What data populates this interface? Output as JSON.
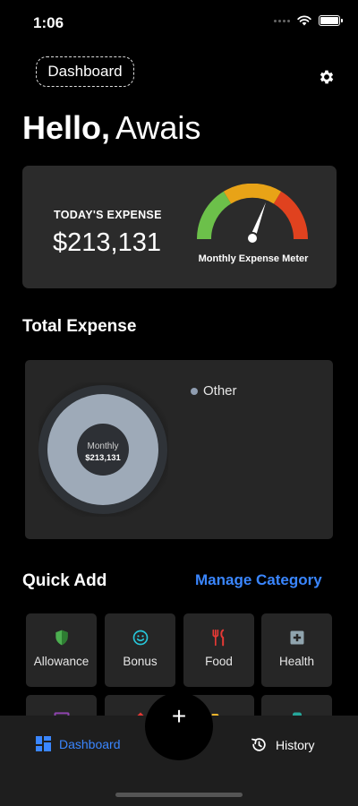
{
  "status": {
    "time": "1:06"
  },
  "header": {
    "chip_label": "Dashboard"
  },
  "greeting": {
    "hello": "Hello,",
    "name": "Awais"
  },
  "today": {
    "label": "TODAY'S EXPENSE",
    "amount": "$213,131",
    "meter_label": "Monthly Expense Meter",
    "meter_colors": [
      "#6cc04a",
      "#e8a317",
      "#e0421f"
    ]
  },
  "total_expense": {
    "title": "Total Expense",
    "center_label": "Monthly",
    "center_value": "$213,131",
    "legend": [
      {
        "label": "Other",
        "color": "#8f9db0"
      }
    ]
  },
  "quick_add": {
    "title": "Quick Add",
    "manage_label": "Manage Category",
    "categories": [
      {
        "label": "Allowance",
        "icon": "shield-icon",
        "color": "#4caf50"
      },
      {
        "label": "Bonus",
        "icon": "smiley-icon",
        "color": "#26c6da"
      },
      {
        "label": "Food",
        "icon": "utensils-icon",
        "color": "#e53935"
      },
      {
        "label": "Health",
        "icon": "medical-cross-icon",
        "color": "#90a4ae"
      },
      {
        "label": "",
        "icon": "tv-icon",
        "color": "#8e44ad"
      },
      {
        "label": "",
        "icon": "home-icon",
        "color": "#e53935"
      },
      {
        "label": "",
        "icon": "folder-icon",
        "color": "#fbc02d"
      },
      {
        "label": "",
        "icon": "jar-icon",
        "color": "#26a69a"
      }
    ]
  },
  "tabs": {
    "dashboard": "Dashboard",
    "history": "History",
    "add": "+"
  },
  "colors": {
    "accent": "#3a86ff",
    "card": "#2b2b2b",
    "background": "#000000"
  }
}
